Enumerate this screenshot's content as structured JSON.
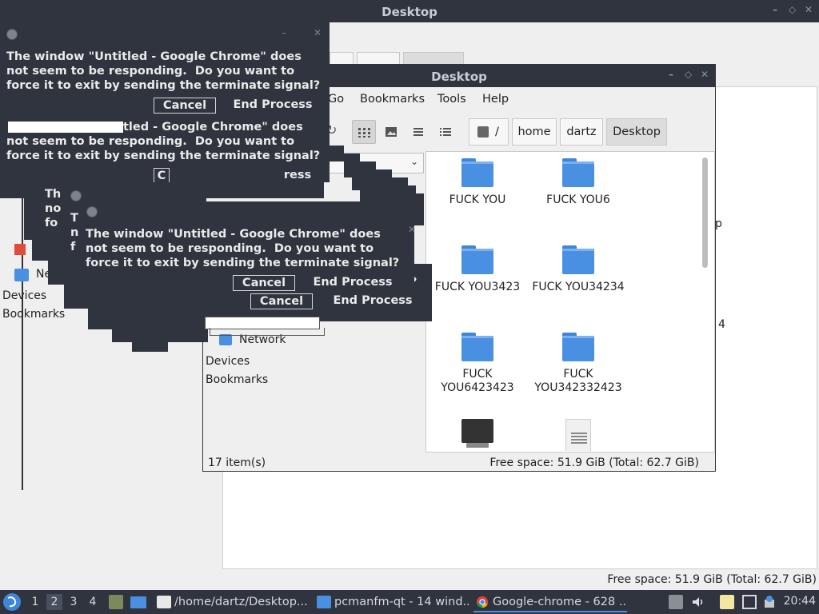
{
  "desktop_title": "Desktop",
  "background_window": {
    "title": "Desktop",
    "sidebar": {
      "network": "Network",
      "devices": "Devices",
      "bookmarks": "Bookmarks"
    },
    "status": "Free space: 51.9 GiB (Total: 62.7 GiB)",
    "fragments": {
      "p": "p",
      "four": "4"
    }
  },
  "dialogs": {
    "message_line1": "The window \"Untitled - Google Chrome\" does",
    "message_line2": "not seem to be responding.  Do you want to",
    "message_line3": "force it to exit by sending the terminate signal?",
    "partial_line1": "tled - Google Chrome\" does",
    "cancel_label": "Cancel",
    "end_process_label": "End Process",
    "frag_c": "C",
    "frag_ress": "ress",
    "frag_th": "Th",
    "frag_no": "no",
    "frag_fo": "fo",
    "frag_question": "?",
    "frag_t": "T",
    "frag_n": "n",
    "frag_f": "f"
  },
  "file_manager": {
    "title": "Desktop",
    "menu": [
      "Go",
      "Bookmarks",
      "Tools",
      "Help"
    ],
    "path_root": "/",
    "path": [
      "home",
      "dartz",
      "Desktop"
    ],
    "sidebar": {
      "network": "Network",
      "devices": "Devices",
      "bookmarks": "Bookmarks"
    },
    "items": [
      {
        "label": "FUCK YOU",
        "icon": "folder-icon"
      },
      {
        "label": "FUCK YOU6",
        "icon": "folder-icon"
      },
      {
        "label": "FUCK YOU3423",
        "icon": "folder-icon"
      },
      {
        "label": "FUCK YOU34234",
        "icon": "folder-icon"
      },
      {
        "label": "FUCK\nYOU6423423",
        "icon": "folder-icon"
      },
      {
        "label": "FUCK\nYOU342332423",
        "icon": "folder-icon"
      }
    ],
    "status_count": "17 item(s)",
    "status_space": "Free space: 51.9 GiB (Total: 62.7 GiB)"
  },
  "taskbar": {
    "workspaces": [
      "1",
      "2",
      "3",
      "4"
    ],
    "active_workspace": "2",
    "tasks": [
      {
        "label": "/home/dartz/Desktop...",
        "icon": "text-editor-icon"
      },
      {
        "label": "pcmanfm-qt - 14 wind...",
        "icon": "folder-icon"
      },
      {
        "label": "Google-chrome - 628 ...",
        "icon": "chrome-icon"
      }
    ],
    "clock": "20:44"
  },
  "colors": {
    "titlebar": "#2f343f",
    "folder": "#4a90e2",
    "accent": "#4a90e2"
  }
}
